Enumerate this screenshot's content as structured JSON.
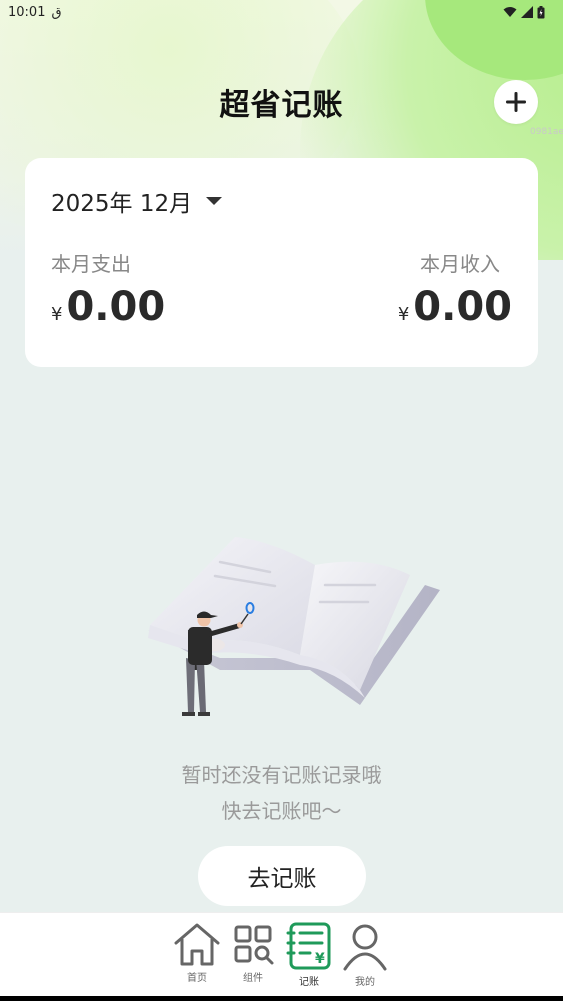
{
  "status_bar": {
    "time": "10:01",
    "carrier_glyph": "ق",
    "icons": [
      "wifi-icon",
      "signal-icon",
      "battery-icon"
    ]
  },
  "header": {
    "title": "超省记账",
    "add_icon": "plus-icon",
    "tag": "0981ae"
  },
  "summary_card": {
    "month": "2025年 12月",
    "expense_label": "本月支出",
    "income_label": "本月收入",
    "currency": "¥",
    "expense_value": "0.00",
    "income_value": "0.00"
  },
  "empty_state": {
    "line1": "暂时还没有记账记录哦",
    "line2": "快去记账吧～",
    "button_label": "去记账"
  },
  "tabbar": {
    "items": [
      {
        "label": "首页",
        "icon": "home-icon"
      },
      {
        "label": "组件",
        "icon": "widgets-icon"
      },
      {
        "label": "记账",
        "icon": "ledger-icon",
        "active": true
      },
      {
        "label": "我的",
        "icon": "user-icon"
      }
    ]
  },
  "colors": {
    "accent": "#1f9a5a",
    "background": "#e8f0ee",
    "blob": "#a6e87c"
  }
}
